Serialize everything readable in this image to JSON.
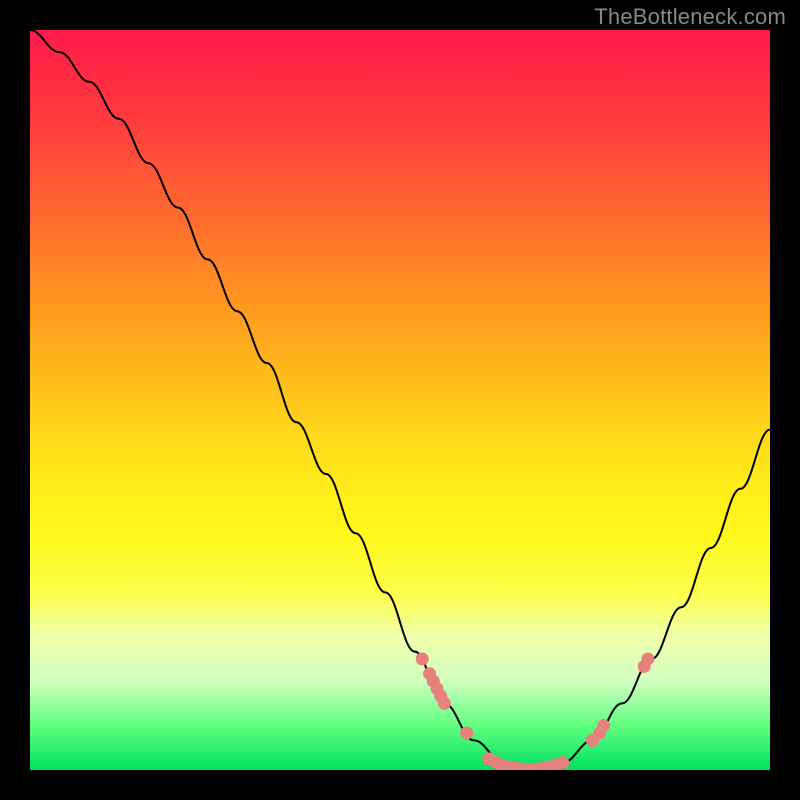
{
  "watermark": "TheBottleneck.com",
  "chart_data": {
    "type": "line",
    "title": "",
    "xlabel": "",
    "ylabel": "",
    "xlim": [
      0,
      100
    ],
    "ylim": [
      0,
      100
    ],
    "curve": [
      {
        "x": 0,
        "y": 100
      },
      {
        "x": 4,
        "y": 97
      },
      {
        "x": 8,
        "y": 93
      },
      {
        "x": 12,
        "y": 88
      },
      {
        "x": 16,
        "y": 82
      },
      {
        "x": 20,
        "y": 76
      },
      {
        "x": 24,
        "y": 69
      },
      {
        "x": 28,
        "y": 62
      },
      {
        "x": 32,
        "y": 55
      },
      {
        "x": 36,
        "y": 47
      },
      {
        "x": 40,
        "y": 40
      },
      {
        "x": 44,
        "y": 32
      },
      {
        "x": 48,
        "y": 24
      },
      {
        "x": 52,
        "y": 16
      },
      {
        "x": 56,
        "y": 9
      },
      {
        "x": 60,
        "y": 4
      },
      {
        "x": 64,
        "y": 1
      },
      {
        "x": 68,
        "y": 0
      },
      {
        "x": 72,
        "y": 1
      },
      {
        "x": 76,
        "y": 4
      },
      {
        "x": 80,
        "y": 9
      },
      {
        "x": 84,
        "y": 15
      },
      {
        "x": 88,
        "y": 22
      },
      {
        "x": 92,
        "y": 30
      },
      {
        "x": 96,
        "y": 38
      },
      {
        "x": 100,
        "y": 46
      }
    ],
    "points": [
      {
        "x": 53,
        "y": 15
      },
      {
        "x": 54,
        "y": 13
      },
      {
        "x": 54.5,
        "y": 12
      },
      {
        "x": 55,
        "y": 11
      },
      {
        "x": 55.5,
        "y": 10
      },
      {
        "x": 56,
        "y": 9
      },
      {
        "x": 59,
        "y": 5
      },
      {
        "x": 62,
        "y": 1.5
      },
      {
        "x": 63,
        "y": 1
      },
      {
        "x": 64,
        "y": 0.6
      },
      {
        "x": 65,
        "y": 0.4
      },
      {
        "x": 66,
        "y": 0.2
      },
      {
        "x": 67,
        "y": 0.1
      },
      {
        "x": 68,
        "y": 0.1
      },
      {
        "x": 69,
        "y": 0.2
      },
      {
        "x": 70,
        "y": 0.4
      },
      {
        "x": 71,
        "y": 0.7
      },
      {
        "x": 72,
        "y": 1
      },
      {
        "x": 76,
        "y": 4
      },
      {
        "x": 77,
        "y": 5
      },
      {
        "x": 77.5,
        "y": 6
      },
      {
        "x": 83,
        "y": 14
      },
      {
        "x": 83.5,
        "y": 15
      }
    ],
    "background_gradient": {
      "top": "#ff1a4a",
      "mid": "#fff81a",
      "bottom": "#00e060"
    }
  }
}
